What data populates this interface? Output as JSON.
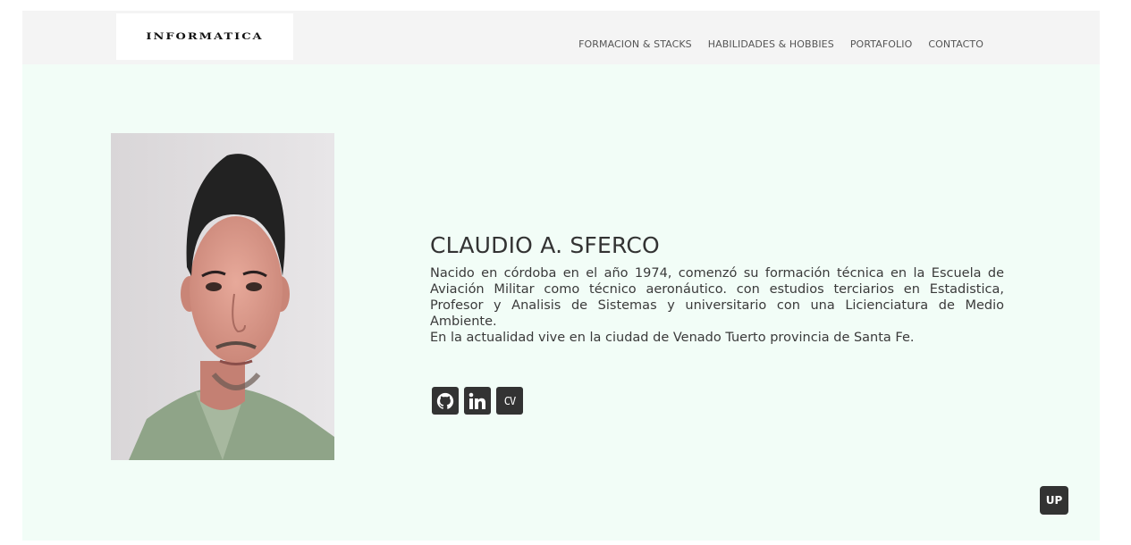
{
  "header": {
    "logo_text": "INFORMATICA",
    "nav": [
      {
        "label": "FORMACION & STACKS"
      },
      {
        "label": "HABILIDADES & HOBBIES"
      },
      {
        "label": "PORTAFOLIO"
      },
      {
        "label": "CONTACTO"
      }
    ]
  },
  "profile": {
    "name": "CLAUDIO A. SFERCO",
    "bio_paragraph": "Nacido en córdoba en el año 1974, comenzó su formación técnica en la Escuela de Aviación Militar como técnico aeronáutico. con estudios terciarios en Estadistica, Profesor y Analisis de Sistemas y universitario con una Licienciatura de Medio Ambiente.",
    "bio_location": "En la actualidad vive en la ciudad de Venado Tuerto provincia de Santa Fe."
  },
  "social": [
    {
      "icon": "github-icon"
    },
    {
      "icon": "linkedin-icon"
    },
    {
      "icon": "cv-icon",
      "label": "CV"
    }
  ],
  "scroll_top": {
    "label": "UP"
  },
  "colors": {
    "page_bg": "#f2fdf7",
    "nav_bg": "#f4f4f4",
    "button_bg": "#333333"
  }
}
